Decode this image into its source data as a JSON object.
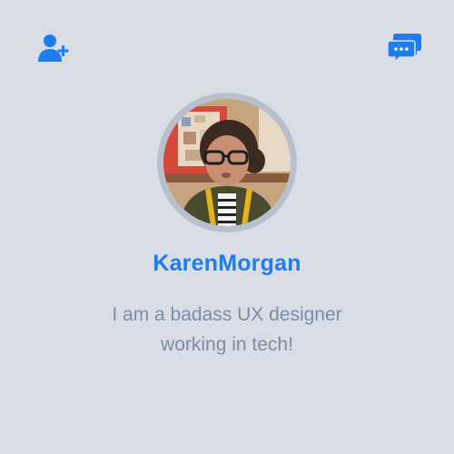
{
  "profile": {
    "name": "KarenMorgan",
    "bio": "I am a badass UX designer working in tech!"
  },
  "icons": {
    "add_user": "add-user-icon",
    "chat": "chat-bubbles-icon"
  },
  "colors": {
    "accent": "#1e7df0",
    "background": "#d8dde6",
    "bio_text": "#7b8ea6",
    "avatar_ring": "#b7c0cc"
  }
}
